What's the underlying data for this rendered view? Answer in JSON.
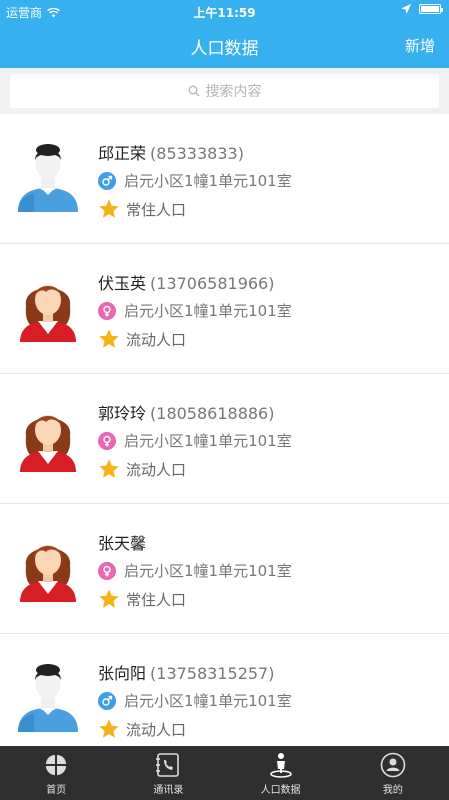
{
  "status_bar": {
    "carrier": "运营商",
    "time": "上午11:59"
  },
  "nav": {
    "title": "人口数据",
    "action": "新增"
  },
  "search": {
    "placeholder": "搜索内容"
  },
  "people": [
    {
      "name": "邱正荣",
      "phone": "(85333833)",
      "address": "启元小区1幢1单元101室",
      "gender": "male",
      "type": "常住人口"
    },
    {
      "name": "伏玉英",
      "phone": "(13706581966)",
      "address": "启元小区1幢1单元101室",
      "gender": "female",
      "type": "流动人口"
    },
    {
      "name": "郭玲玲",
      "phone": "(18058618886)",
      "address": "启元小区1幢1单元101室",
      "gender": "female",
      "type": "流动人口"
    },
    {
      "name": "张天馨",
      "phone": "",
      "address": "启元小区1幢1单元101室",
      "gender": "female",
      "type": "常住人口"
    },
    {
      "name": "张向阳",
      "phone": "(13758315257)",
      "address": "启元小区1幢1单元101室",
      "gender": "male",
      "type": "流动人口"
    }
  ],
  "tabs": [
    {
      "label": "首页",
      "icon": "home-grid-icon"
    },
    {
      "label": "通讯录",
      "icon": "contacts-phone-icon"
    },
    {
      "label": "人口数据",
      "icon": "person-location-icon"
    },
    {
      "label": "我的",
      "icon": "profile-icon"
    }
  ],
  "colors": {
    "primary": "#36b0ee",
    "male": "#3f9ee8",
    "female": "#ea67b4",
    "star": "#f4b318",
    "tab_bar": "#2f2f2f"
  }
}
